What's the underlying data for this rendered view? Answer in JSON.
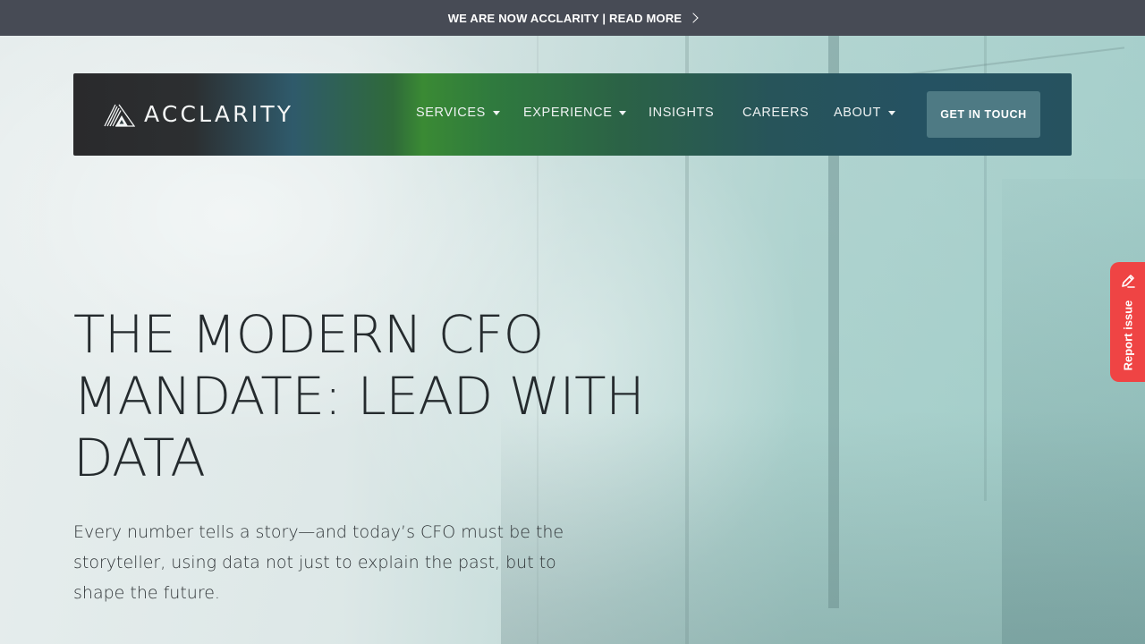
{
  "announcement": {
    "text": "WE ARE NOW ACCLARITY | READ MORE",
    "icon": "chevron-right-icon"
  },
  "nav": {
    "logo_text": "ACCLARITY",
    "logo_icon": "acclarity-mountain-logo",
    "items": [
      {
        "label": "SERVICES",
        "has_dropdown": true
      },
      {
        "label": "EXPERIENCE",
        "has_dropdown": true
      },
      {
        "label": "INSIGHTS",
        "has_dropdown": false
      },
      {
        "label": "CAREERS",
        "has_dropdown": false
      },
      {
        "label": "ABOUT",
        "has_dropdown": true
      }
    ],
    "cta_label": "GET IN TOUCH"
  },
  "hero": {
    "title": "THE MODERN CFO MANDATE: LEAD WITH DATA",
    "subtitle": "Every number tells a story—and today’s CFO must be the storyteller, using data not just to explain the past, but to shape the future."
  },
  "report_tab": {
    "label": "Report issue",
    "icon": "pencil-icon"
  },
  "colors": {
    "announcement_bg": "#474b55",
    "cta_bg": "#4e7a84",
    "report_bg": "#ef4444",
    "nav_green": "#3a8a34"
  }
}
